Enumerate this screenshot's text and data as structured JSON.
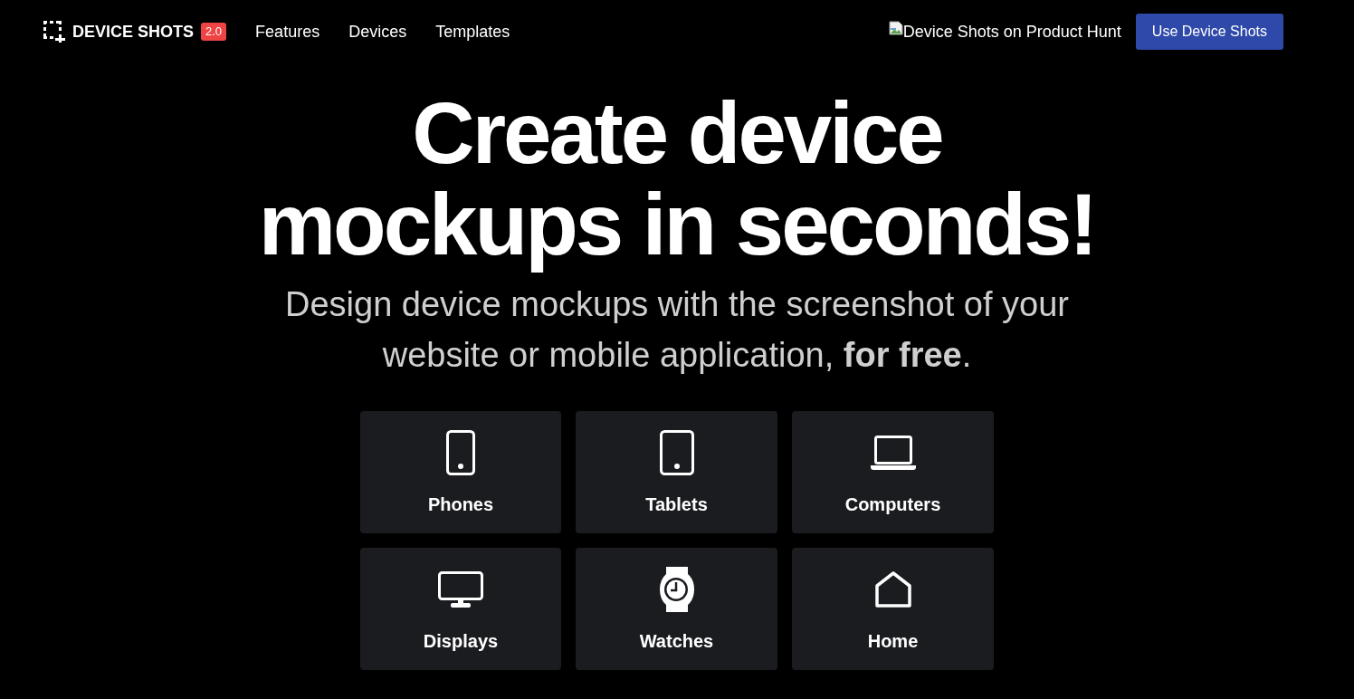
{
  "nav": {
    "logo": {
      "text": "DEVICE SHOTS",
      "badge": "2.0"
    },
    "links": [
      "Features",
      "Devices",
      "Templates"
    ],
    "product_hunt_alt": "Device Shots on Product Hunt",
    "cta": "Use Device Shots"
  },
  "hero": {
    "title": "Create device mockups in seconds!",
    "subtitle": "Design device mockups with the screenshot of your website or mobile application, **for free**."
  },
  "categories": [
    {
      "label": "Phones",
      "kind": "phone"
    },
    {
      "label": "Tablets",
      "kind": "tablet"
    },
    {
      "label": "Computers",
      "kind": "laptop"
    },
    {
      "label": "Displays",
      "kind": "display"
    },
    {
      "label": "Watches",
      "kind": "watch"
    },
    {
      "label": "Home",
      "kind": "home"
    }
  ]
}
